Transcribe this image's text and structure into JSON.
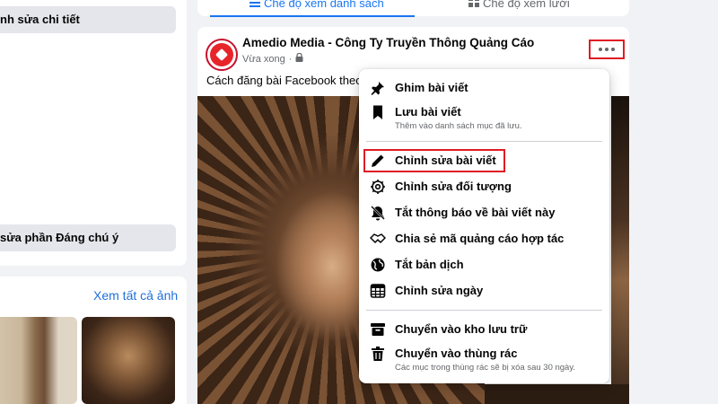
{
  "left": {
    "edit_details_button": "nh sửa chi tiết",
    "edit_featured_button": "sửa phần Đáng chú ý",
    "see_all_photos": "Xem tất cả ảnh"
  },
  "view_tabs": {
    "list_view": "Chế độ xem danh sách",
    "grid_view": "Chế độ xem lưới"
  },
  "post": {
    "page_name": "Amedio Media - Công Ty Truyền Thông Quảng Cáo",
    "timestamp": "Vừa xong",
    "separator": "·",
    "text": "Cách đăng bài Facebook theo đ"
  },
  "menu": {
    "items": [
      {
        "label": "Ghim bài viết",
        "icon": "pin-icon"
      },
      {
        "label": "Lưu bài viết",
        "sub": "Thêm vào danh sách mục đã lưu.",
        "icon": "bookmark-icon"
      },
      {
        "label": "Chỉnh sửa bài viết",
        "icon": "pencil-icon"
      },
      {
        "label": "Chỉnh sửa đối tượng",
        "icon": "gear-icon"
      },
      {
        "label": "Tắt thông báo về bài viết này",
        "icon": "bell-off-icon"
      },
      {
        "label": "Chia sẻ mã quảng cáo hợp tác",
        "icon": "handshake-icon"
      },
      {
        "label": "Tắt bản dịch",
        "icon": "globe-icon"
      },
      {
        "label": "Chỉnh sửa ngày",
        "icon": "calendar-icon"
      },
      {
        "label": "Chuyển vào kho lưu trữ",
        "icon": "archive-icon"
      },
      {
        "label": "Chuyển vào thùng rác",
        "sub": "Các mục trong thùng rác sẽ bị xóa sau 30 ngày.",
        "icon": "trash-icon"
      }
    ]
  },
  "colors": {
    "accent": "#1877f2",
    "highlight_border": "#e01b24",
    "link": "#216fdb"
  }
}
